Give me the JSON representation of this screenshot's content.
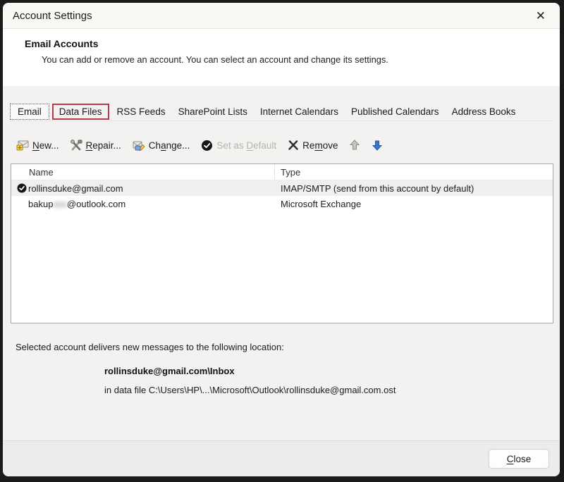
{
  "window": {
    "title": "Account Settings",
    "close_icon": "✕"
  },
  "header": {
    "title": "Email Accounts",
    "description": "You can add or remove an account. You can select an account and change its settings."
  },
  "tabs": {
    "items": [
      {
        "label": "Email",
        "active": true
      },
      {
        "label": "Data Files",
        "annotated": true
      },
      {
        "label": "RSS Feeds"
      },
      {
        "label": "SharePoint Lists"
      },
      {
        "label": "Internet Calendars"
      },
      {
        "label": "Published Calendars"
      },
      {
        "label": "Address Books"
      }
    ]
  },
  "toolbar": {
    "new": {
      "pre": "",
      "key": "N",
      "post": "ew..."
    },
    "repair": {
      "pre": "",
      "key": "R",
      "post": "epair..."
    },
    "change": {
      "pre": "Ch",
      "key": "a",
      "post": "nge..."
    },
    "set_default": {
      "pre": "Set as ",
      "key": "D",
      "post": "efault",
      "state": "disabled"
    },
    "remove": {
      "pre": "Re",
      "key": "m",
      "post": "ove"
    }
  },
  "table": {
    "columns": [
      "Name",
      "Type"
    ],
    "rows": [
      {
        "name": "rollinsduke@gmail.com",
        "type": "IMAP/SMTP (send from this account by default)",
        "is_default": true,
        "selected": true
      },
      {
        "name_pre": "bakup",
        "name_redacted": "xxx",
        "name_post": "@outlook.com",
        "type": "Microsoft Exchange"
      }
    ]
  },
  "info": {
    "line1": "Selected account delivers new messages to the following location:",
    "location": "rollinsduke@gmail.com\\Inbox",
    "datafile": "in data file C:\\Users\\HP\\...\\Microsoft\\Outlook\\rollinsduke@gmail.com.ost"
  },
  "footer": {
    "close": {
      "pre": "",
      "key": "C",
      "post": "lose"
    }
  },
  "colors": {
    "annotation_red": "#b73a4a",
    "down_arrow_blue": "#3a76c4",
    "dialog_background": "#f3f2f0"
  },
  "icons": {
    "titlebar": "close-icon",
    "toolbar": [
      "new-account-icon",
      "repair-icon",
      "change-icon",
      "set-default-icon",
      "remove-icon",
      "move-up-icon",
      "move-down-icon"
    ],
    "row_marker": "default-account-check-icon"
  }
}
